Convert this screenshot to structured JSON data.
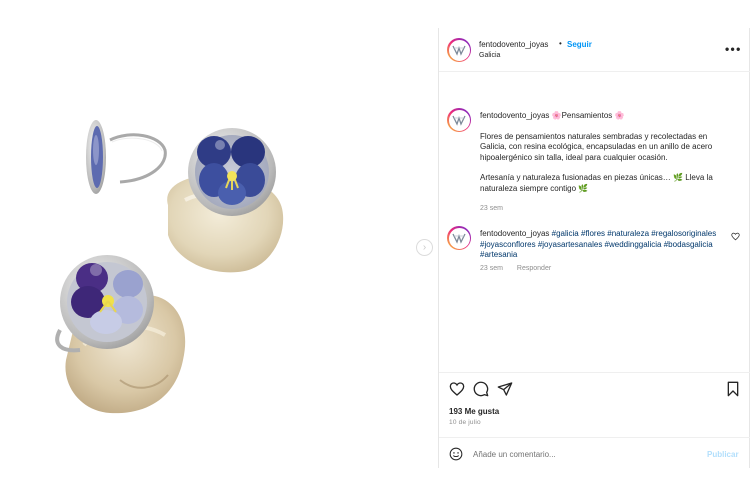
{
  "post": {
    "username": "fentodovento_joyas",
    "separator": "•",
    "follow_label": "Seguir",
    "location": "Galicia",
    "more_icon": "more-horizontal-icon"
  },
  "caption": {
    "username": "fentodovento_joyas",
    "title": "🌸Pensamientos 🌸",
    "paragraph1": "Flores de pensamientos naturales sembradas y recolectadas en Galicia, con resina ecológica, encapsuladas en un anillo de acero hipoalergénico sin talla, ideal para cualquier ocasión.",
    "paragraph2": "Artesanía y naturaleza fusionadas en piezas únicas… 🌿 Lleva la naturaleza siempre contigo 🌿",
    "time": "23 sem"
  },
  "comment": {
    "username": "fentodovento_joyas",
    "hashtags": [
      "#galicia",
      "#flores",
      "#naturaleza",
      "#regalosoriginales",
      "#joyasconflores",
      "#joyasartesanales",
      "#weddinggalicia",
      "#bodasgalicia",
      "#artesania"
    ],
    "time": "23 sem",
    "reply_label": "Responder"
  },
  "actions": {
    "icons": [
      "heart-icon",
      "comment-icon",
      "share-icon",
      "bookmark-icon"
    ],
    "likes": "193 Me gusta",
    "date": "10 de julio"
  },
  "comment_bar": {
    "placeholder": "Añade un comentario...",
    "publish_label": "Publicar",
    "emoji_icon": "emoji-icon"
  },
  "colors": {
    "accent": "#0095f6",
    "hashtag": "#00376b",
    "muted": "#8e8e8e",
    "publish_disabled": "#b2dffc"
  }
}
